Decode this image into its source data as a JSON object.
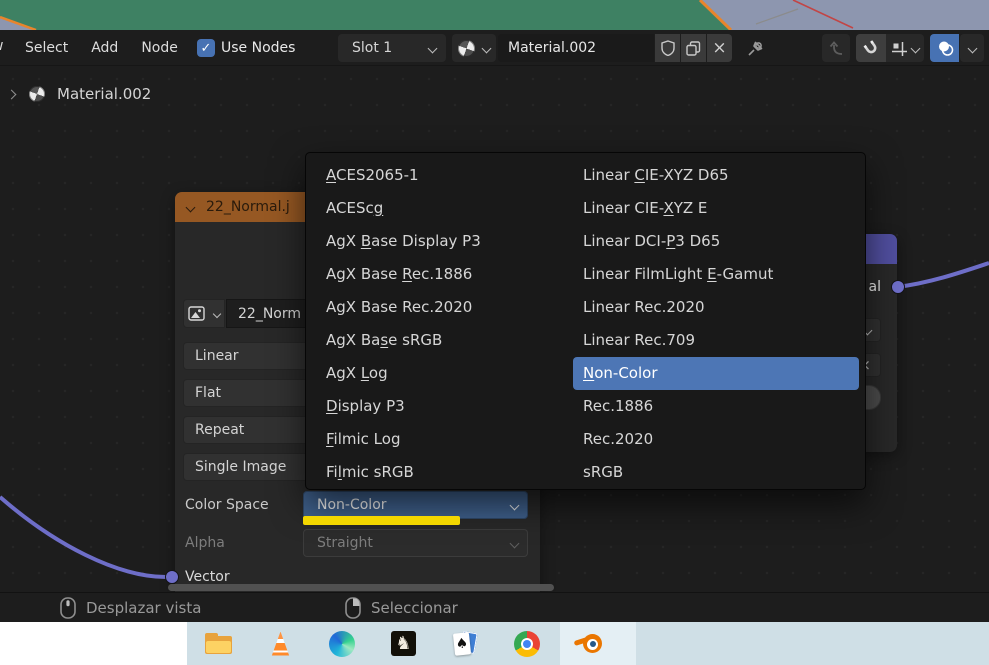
{
  "header": {
    "menu_fragment": "w",
    "menus": [
      "Select",
      "Add",
      "Node"
    ],
    "use_nodes_label": "Use Nodes",
    "slot": "Slot 1",
    "material_name": "Material.002"
  },
  "breadcrumb": {
    "material": "Material.002"
  },
  "image_node": {
    "title": "22_Normal.j",
    "image_name": "22_Norm",
    "interpolation": "Linear",
    "projection": "Flat",
    "extension": "Repeat",
    "source": "Single Image",
    "color_space_label": "Color Space",
    "color_space_value": "Non-Color",
    "alpha_label": "Alpha",
    "alpha_value": "Straight",
    "vector_label": "Vector"
  },
  "normal_node": {
    "output_label": "al"
  },
  "color_space_menu": {
    "selected": "Non-Color",
    "columns": [
      [
        {
          "text": "ACES2065-1",
          "accel": 0
        },
        {
          "text": "ACEScg",
          "accel": 5
        },
        {
          "text": "AgX Base Display P3",
          "accel": 4
        },
        {
          "text": "AgX Base Rec.1886",
          "accel": 9
        },
        {
          "text": "AgX Base Rec.2020",
          "accel": -1
        },
        {
          "text": "AgX Base sRGB",
          "accel": 6
        },
        {
          "text": "AgX Log",
          "accel": 4
        },
        {
          "text": "Display P3",
          "accel": 0
        },
        {
          "text": "Filmic Log",
          "accel": 0
        },
        {
          "text": "Filmic sRGB",
          "accel": 2
        }
      ],
      [
        {
          "text": "Linear CIE-XYZ D65",
          "accel": 7
        },
        {
          "text": "Linear CIE-XYZ E",
          "accel": 11
        },
        {
          "text": "Linear DCI-P3 D65",
          "accel": 11
        },
        {
          "text": "Linear FilmLight E-Gamut",
          "accel": 17
        },
        {
          "text": "Linear Rec.2020",
          "accel": -1
        },
        {
          "text": "Linear Rec.709",
          "accel": -1
        },
        {
          "text": "Non-Color",
          "accel": 0,
          "selected": true
        },
        {
          "text": "Rec.1886",
          "accel": -1
        },
        {
          "text": "Rec.2020",
          "accel": -1
        },
        {
          "text": "sRGB",
          "accel": -1
        }
      ]
    ]
  },
  "status_bar": {
    "items": [
      {
        "icon": "mouse-middle-icon",
        "label": "Desplazar vista"
      },
      {
        "icon": "mouse-right-icon",
        "label": "Seleccionar"
      }
    ]
  },
  "taskbar": {
    "apps": [
      "file-explorer",
      "vlc",
      "edge",
      "chess",
      "solitaire",
      "chrome",
      "blender"
    ],
    "active": "blender"
  },
  "colors": {
    "accent_blue": "#4772b3",
    "menu_highlight": "#4d76b5",
    "image_node_header": "#965823",
    "normal_node_header": "#504e9e",
    "wire_purple": "#6e6ec8",
    "marker_yellow": "#f3d700",
    "colorspace_dropdown": "#3e5f8a"
  }
}
